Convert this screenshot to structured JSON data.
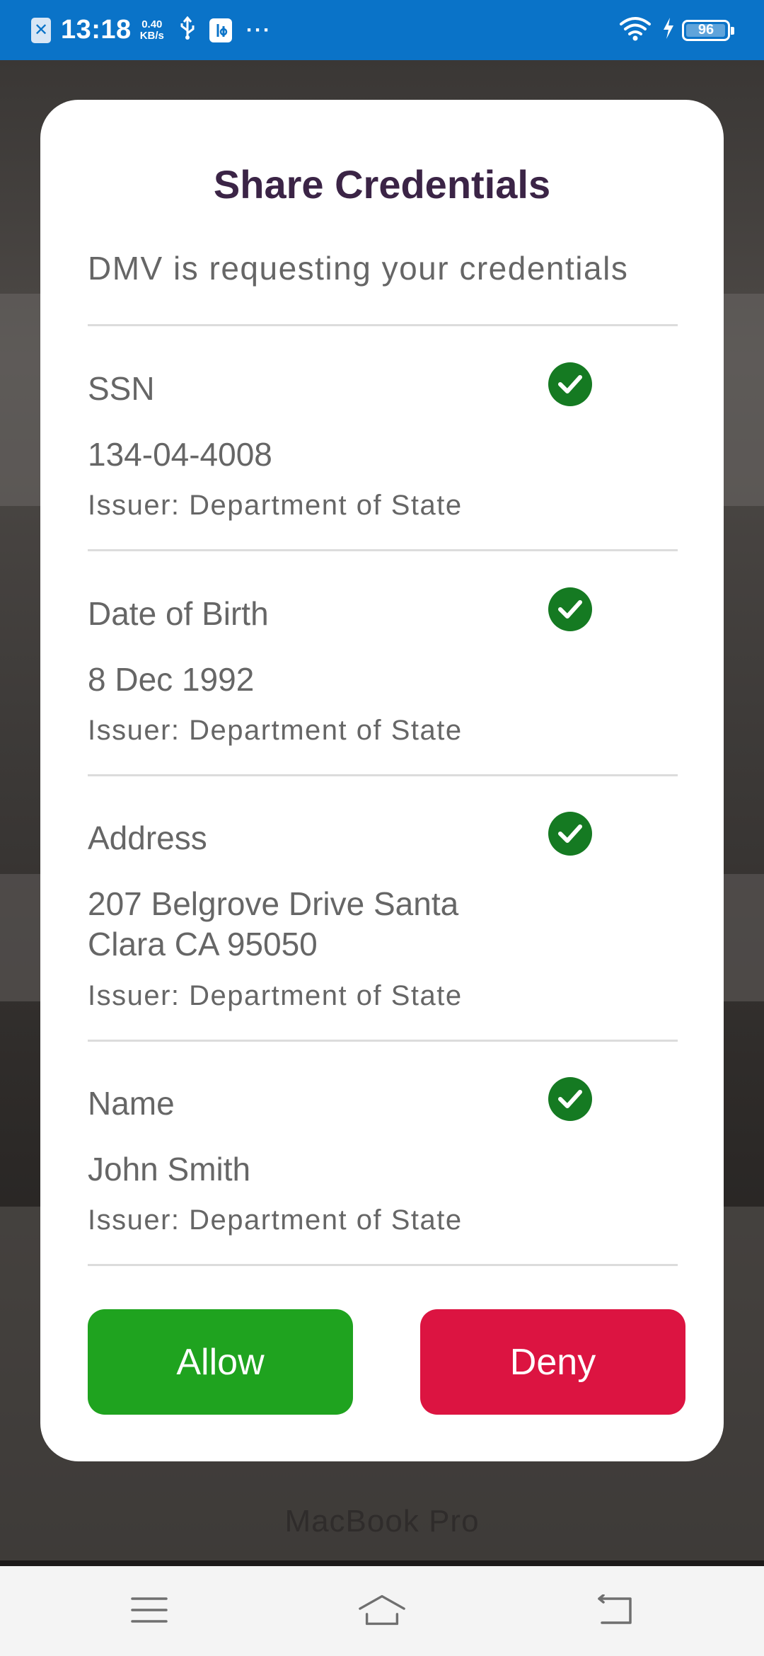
{
  "status_bar": {
    "time": "13:18",
    "speed_value": "0.40",
    "speed_unit": "KB/s",
    "app_icon": "x-app-icon",
    "more": "···",
    "battery": "96"
  },
  "backdrop": {
    "bottom_text": "MacBook Pro"
  },
  "dialog": {
    "title": "Share Credentials",
    "subtitle": "DMV is requesting your credentials",
    "credentials": [
      {
        "label": "SSN",
        "value": "134-04-4008",
        "issuer": "Issuer: Department of State",
        "checked": true
      },
      {
        "label": "Date of Birth",
        "value": "8 Dec 1992",
        "issuer": "Issuer: Department of State",
        "checked": true
      },
      {
        "label": "Address",
        "value": "207 Belgrove Drive Santa Clara CA 95050",
        "issuer": "Issuer: Department of State",
        "checked": true
      },
      {
        "label": "Name",
        "value": "John Smith",
        "issuer": "Issuer: Department of State",
        "checked": true
      }
    ],
    "allow_label": "Allow",
    "deny_label": "Deny"
  },
  "colors": {
    "status_bar": "#0a73c8",
    "title": "#3b2446",
    "check": "#157a22",
    "allow": "#1fa31f",
    "deny": "#dc1441"
  },
  "nav_bar": {
    "icons": [
      "menu-icon",
      "home-icon",
      "back-icon"
    ]
  }
}
